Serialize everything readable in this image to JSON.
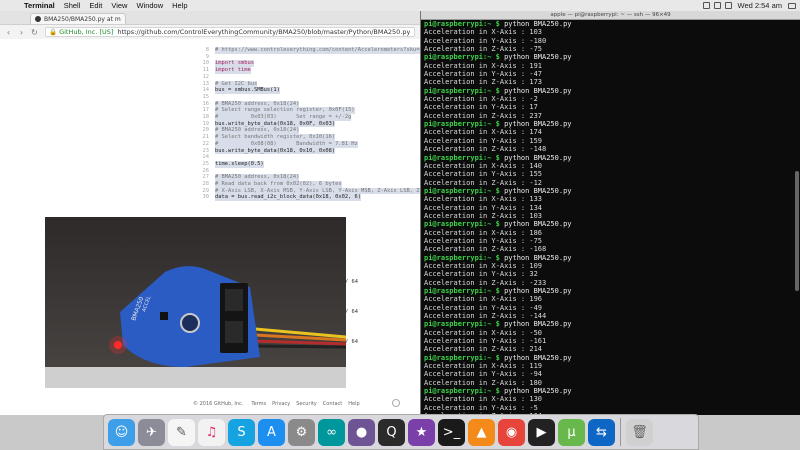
{
  "menubar": {
    "apple": "",
    "items": [
      "Terminal",
      "Shell",
      "Edit",
      "View",
      "Window",
      "Help"
    ],
    "window_title": "apple — pi@raspberrypi: ~ — ssh — 96×49",
    "clock": "Wed 2:54 am"
  },
  "browser": {
    "tab_title": "BMA250/BMA250.py at m",
    "secure_label": "GitHub, Inc. [US]",
    "url": "https://github.com/ControlEverythingCommunity/BMA250/blob/master/Python/BMA250.py",
    "code_lines": [
      {
        "n": "8",
        "t": "# https://www.controleverything.com/content/Accelerometers?sku=BMA250_I2CS#tabs-0-product_tabset-2",
        "c": "comment"
      },
      {
        "n": "9",
        "t": "",
        "c": ""
      },
      {
        "n": "10",
        "t": "import smbus",
        "c": "kw"
      },
      {
        "n": "11",
        "t": "import time",
        "c": "kw"
      },
      {
        "n": "12",
        "t": "",
        "c": ""
      },
      {
        "n": "13",
        "t": "# Get I2C bus",
        "c": "comment"
      },
      {
        "n": "14",
        "t": "bus = smbus.SMBus(1)",
        "c": ""
      },
      {
        "n": "15",
        "t": "",
        "c": ""
      },
      {
        "n": "16",
        "t": "# BMA250 address, 0x18(24)",
        "c": "comment"
      },
      {
        "n": "17",
        "t": "# Select range selection register, 0x0F(15)",
        "c": "comment"
      },
      {
        "n": "18",
        "t": "#          0x03(03)      Set range = +/-2g",
        "c": "comment"
      },
      {
        "n": "19",
        "t": "bus.write_byte_data(0x18, 0x0F, 0x03)",
        "c": ""
      },
      {
        "n": "20",
        "t": "# BMA250 address, 0x18(24)",
        "c": "comment"
      },
      {
        "n": "21",
        "t": "# Select bandwidth register, 0x10(16)",
        "c": "comment"
      },
      {
        "n": "22",
        "t": "#          0x08(08)      Bandwidth = 7.81 Hz",
        "c": "comment"
      },
      {
        "n": "23",
        "t": "bus.write_byte_data(0x18, 0x10, 0x08)",
        "c": ""
      },
      {
        "n": "24",
        "t": "",
        "c": ""
      },
      {
        "n": "25",
        "t": "time.sleep(0.5)",
        "c": ""
      },
      {
        "n": "26",
        "t": "",
        "c": ""
      },
      {
        "n": "27",
        "t": "# BMA250 address, 0x18(24)",
        "c": "comment"
      },
      {
        "n": "28",
        "t": "# Read data back from 0x02(02), 6 bytes",
        "c": "comment"
      },
      {
        "n": "29",
        "t": "# X-Axis LSB, X-Axis MSB, Y-Axis LSB, Y-Axis MSB, Z-Axis LSB, Z-Axis MSB",
        "c": "comment"
      },
      {
        "n": "30",
        "t": "data = bus.read_i2c_block_data(0x18, 0x02, 6)",
        "c": ""
      }
    ],
    "after_code": [
      "/ 64",
      "/ 64",
      "/ 64"
    ],
    "footer": {
      "copyright": "© 2016 GitHub, Inc.",
      "links": [
        "Terms",
        "Privacy",
        "Security",
        "Contact",
        "Help"
      ]
    }
  },
  "photo": {
    "board_label": "BMA250",
    "board_text_2": "ACCEL"
  },
  "terminal": {
    "title": "apple — pi@raspberrypi: ~ — ssh — 96×49",
    "prompt_user": "pi@raspberrypi:~ $",
    "command": "python BMA250.py",
    "readings": [
      {
        "x": "103",
        "y": "-180",
        "z": "-75"
      },
      {
        "x": "191",
        "y": "-47",
        "z": "173"
      },
      {
        "x": "-2",
        "y": "17",
        "z": "237"
      },
      {
        "x": "174",
        "y": "159",
        "z": "-148"
      },
      {
        "x": "140",
        "y": "155",
        "z": "-12"
      },
      {
        "x": "133",
        "y": "134",
        "z": "103"
      },
      {
        "x": "186",
        "y": "-75",
        "z": "-168"
      },
      {
        "x": "109",
        "y": "32",
        "z": "-233"
      },
      {
        "x": "196",
        "y": "-49",
        "z": "-144"
      },
      {
        "x": "-50",
        "y": "-161",
        "z": "214"
      },
      {
        "x": "119",
        "y": "-94",
        "z": "180"
      },
      {
        "x": "130",
        "y": "-5",
        "z": "164"
      }
    ],
    "labels": {
      "x": "Acceleration in X-Axis : ",
      "y": "Acceleration in Y-Axis : ",
      "z": "Acceleration in Z-Axis : "
    },
    "dim_text": "BMA250.py  python BMA250.py"
  },
  "dock": {
    "apps": [
      {
        "name": "finder-icon",
        "glyph": "☺",
        "bg": "#3f9ee8"
      },
      {
        "name": "launchpad-icon",
        "glyph": "✈",
        "bg": "#8c8c99"
      },
      {
        "name": "pages-icon",
        "glyph": "✎",
        "bg": "#f5f5f5",
        "fg": "#555"
      },
      {
        "name": "itunes-icon",
        "glyph": "♫",
        "bg": "#f2f2f2",
        "fg": "#e0306a"
      },
      {
        "name": "skype-icon",
        "glyph": "S",
        "bg": "#15a3e2"
      },
      {
        "name": "app-store-icon",
        "glyph": "A",
        "bg": "#1c8ff0"
      },
      {
        "name": "system-preferences-icon",
        "glyph": "⚙",
        "bg": "#8a8a8a"
      },
      {
        "name": "arduino-icon",
        "glyph": "∞",
        "bg": "#00979c"
      },
      {
        "name": "github-desktop-icon",
        "glyph": "●",
        "bg": "#6e5494"
      },
      {
        "name": "quicktime-icon",
        "glyph": "Q",
        "bg": "#2b2b2b"
      },
      {
        "name": "imovie-icon",
        "glyph": "★",
        "bg": "#7b3fa9"
      },
      {
        "name": "terminal-icon",
        "glyph": ">_",
        "bg": "#1a1a1a"
      },
      {
        "name": "vlc-icon",
        "glyph": "▲",
        "bg": "#f48a1a"
      },
      {
        "name": "chrome-icon",
        "glyph": "◉",
        "bg": "#e7453b"
      },
      {
        "name": "media-player-icon",
        "glyph": "▶",
        "bg": "#222"
      },
      {
        "name": "utorrent-icon",
        "glyph": "µ",
        "bg": "#69b84c"
      },
      {
        "name": "teamviewer-icon",
        "glyph": "⇆",
        "bg": "#0e67c5"
      }
    ],
    "trash": {
      "name": "trash-icon",
      "glyph": "🗑",
      "bg": "#d0d0d0"
    }
  }
}
